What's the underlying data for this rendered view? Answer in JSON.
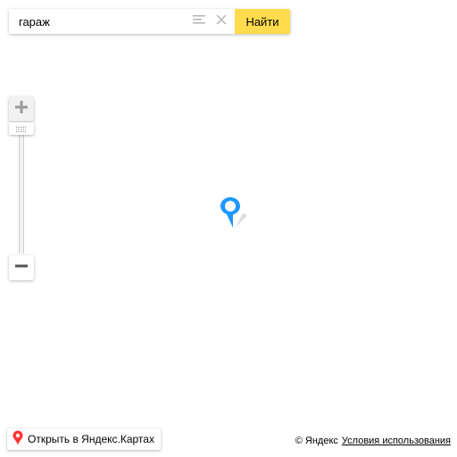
{
  "search": {
    "value": "гараж",
    "button_label": "Найти"
  },
  "icons": {
    "suggest": "list-lines-icon",
    "clear": "close-icon",
    "zoom_in": "plus-icon",
    "zoom_out": "minus-icon",
    "zoom_thumb": "grip-dots-icon",
    "placemark": "map-pin-icon",
    "open_pin": "red-pin-icon"
  },
  "zoom": {
    "level_fraction": 0.0
  },
  "open_in_maps": {
    "label": "Открыть в Яндекс.Картах"
  },
  "copyrights": {
    "owner": "© Яндекс",
    "terms_label": "Условия использования"
  },
  "colors": {
    "accent_yellow": "#ffdb4d",
    "placemark_blue": "#1e98ff",
    "pin_red": "#ff3333"
  }
}
